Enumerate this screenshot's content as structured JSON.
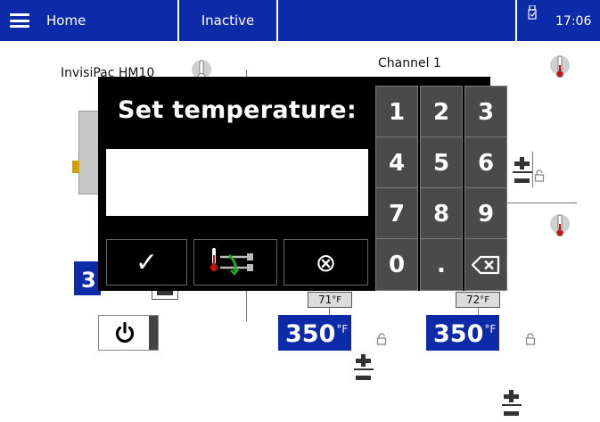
{
  "topbar": {
    "home_label": "Home",
    "status_label": "Inactive",
    "time": "17:06",
    "icons": {
      "menu": "hamburger-menu-icon",
      "usb": "usb-drive-icon"
    }
  },
  "background": {
    "device_label": "InvisiPac HM10",
    "channel_label": "Channel 1",
    "left_setpoint_partial": "3",
    "temp_readings": [
      {
        "value": "71",
        "unit": "°F"
      },
      {
        "value": "72",
        "unit": "°F"
      }
    ],
    "setpoints": [
      {
        "value": "350",
        "unit": "°F"
      },
      {
        "value": "350",
        "unit": "°F"
      }
    ]
  },
  "dialog": {
    "title": "Set temperature:",
    "input_value": "",
    "ok_symbol": "✓",
    "cancel_symbol": "⊗",
    "keys": [
      "1",
      "2",
      "3",
      "4",
      "5",
      "6",
      "7",
      "8",
      "9",
      "0",
      "."
    ],
    "backspace_icon": "backspace-icon",
    "sensor_icon": "sensor-link-icon"
  },
  "colors": {
    "brand_blue": "#0d2aa8",
    "dialog_bg": "#000000",
    "key_bg": "#4a4a4a",
    "thermometer_red": "#cc1111",
    "link_green": "#22aa22"
  }
}
